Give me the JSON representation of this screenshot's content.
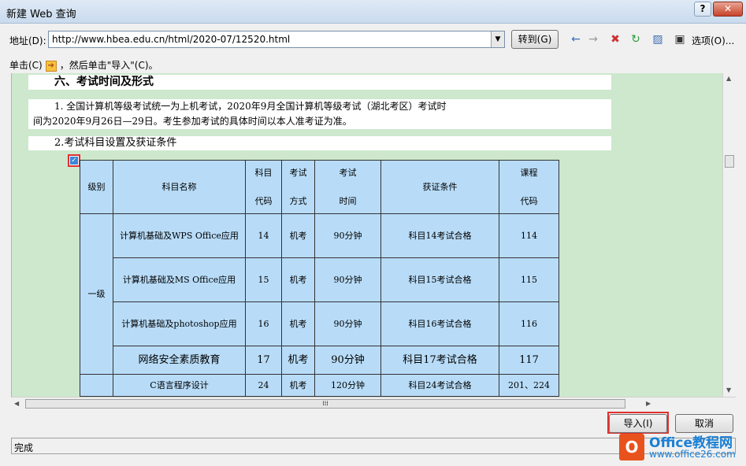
{
  "window": {
    "title": "新建 Web 查询",
    "help": "?",
    "close": "✕"
  },
  "address": {
    "label": "地址(D):",
    "url": "http://www.hbea.edu.cn/html/2020-07/12520.html",
    "go": "转到(G)"
  },
  "toolbar": {
    "options": "选项(O)..."
  },
  "hint": {
    "before": "单击(C)",
    "after": "，然后单击\"导入\"(C)。"
  },
  "content": {
    "section_title": "六、考试时间及形式",
    "para_line1": "1. 全国计算机等级考试统一为上机考试，2020年9月全国计算机等级考试（湖北考区）考试时",
    "para_line2": "间为2020年9月26日—29日。考生参加考试的具体时间以本人准考证为准。",
    "sub_title": "2.考试科目设置及获证条件"
  },
  "table": {
    "headers": {
      "level": "级别",
      "name": "科目名称",
      "code1": "科目",
      "code2": "代码",
      "mode1": "考试",
      "mode2": "方式",
      "time1": "考试",
      "time2": "时间",
      "cond": "获证条件",
      "course1": "课程",
      "course2": "代码"
    },
    "level1": "一级",
    "rows": [
      {
        "name": "计算机基础及WPS Office应用",
        "code": "14",
        "mode": "机考",
        "time": "90分钟",
        "cond": "科目14考试合格",
        "course": "114"
      },
      {
        "name": "计算机基础及MS Office应用",
        "code": "15",
        "mode": "机考",
        "time": "90分钟",
        "cond": "科目15考试合格",
        "course": "115"
      },
      {
        "name": "计算机基础及photoshop应用",
        "code": "16",
        "mode": "机考",
        "time": "90分钟",
        "cond": "科目16考试合格",
        "course": "116"
      },
      {
        "name": "网络安全素质教育",
        "code": "17",
        "mode": "机考",
        "time": "90分钟",
        "cond": "科目17考试合格",
        "course": "117"
      },
      {
        "name": "C语言程序设计",
        "code": "24",
        "mode": "机考",
        "time": "120分钟",
        "cond": "科目24考试合格",
        "course": "201、224"
      }
    ]
  },
  "buttons": {
    "import": "导入(I)",
    "cancel": "取消"
  },
  "status": "完成",
  "watermark": {
    "line1": "Office教程网",
    "line2": "www.office26.com"
  }
}
